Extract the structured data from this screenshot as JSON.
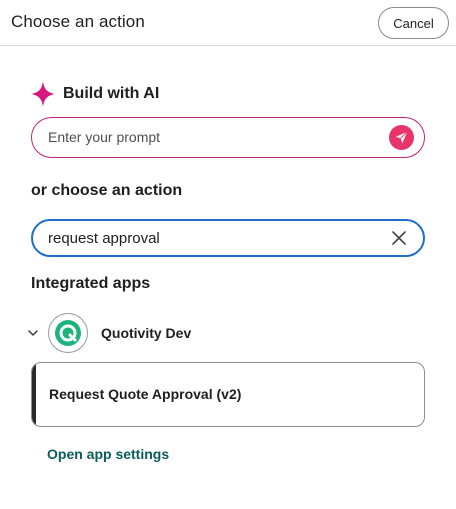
{
  "header": {
    "title": "Choose an action",
    "cancel_label": "Cancel"
  },
  "ai": {
    "icon": "sparkle-icon",
    "title": "Build with AI",
    "prompt_placeholder": "Enter your prompt",
    "prompt_value": "",
    "send_icon": "paper-plane-icon"
  },
  "actions": {
    "label": "or choose an action",
    "search_value": "request approval",
    "clear_icon": "close-icon"
  },
  "integrated": {
    "label": "Integrated apps",
    "apps": [
      {
        "name": "Quotivity Dev",
        "expanded": true,
        "actions": [
          {
            "label": "Request Quote Approval (v2)"
          }
        ],
        "settings_link": "Open app settings"
      }
    ]
  },
  "colors": {
    "ai_accent": "#c4227c",
    "send_button": "#e8336b",
    "search_border": "#1e6ec8",
    "link": "#0b5c5c",
    "app_logo": "#1fb37c"
  }
}
